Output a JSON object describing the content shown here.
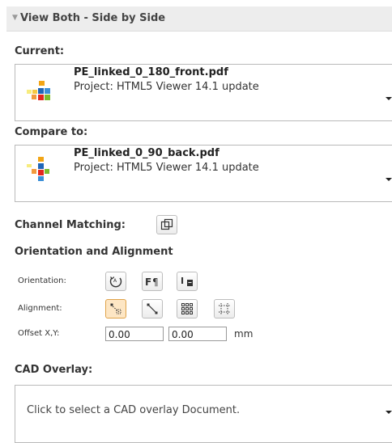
{
  "header": {
    "title": "View Both - Side by Side"
  },
  "current": {
    "label": "Current:",
    "file": "PE_linked_0_180_front.pdf",
    "project": "Project: HTML5 Viewer 14.1 update"
  },
  "compare": {
    "label": "Compare to:",
    "file": "PE_linked_0_90_back.pdf",
    "project": "Project: HTML5 Viewer 14.1 update"
  },
  "channel_matching": {
    "label": "Channel Matching:"
  },
  "orientation_alignment": {
    "title": "Orientation and Alignment",
    "orientation_label": "Orientation:",
    "alignment_label": "Alignment:",
    "offset_label": "Offset X,Y:",
    "offset_x": "0.00",
    "offset_y": "0.00",
    "unit": "mm"
  },
  "cad_overlay": {
    "label": "CAD Overlay:",
    "placeholder": "Click to select a CAD overlay Document."
  },
  "colors": {
    "accent_active": "#fde6c4",
    "header_bg": "#ededed"
  }
}
